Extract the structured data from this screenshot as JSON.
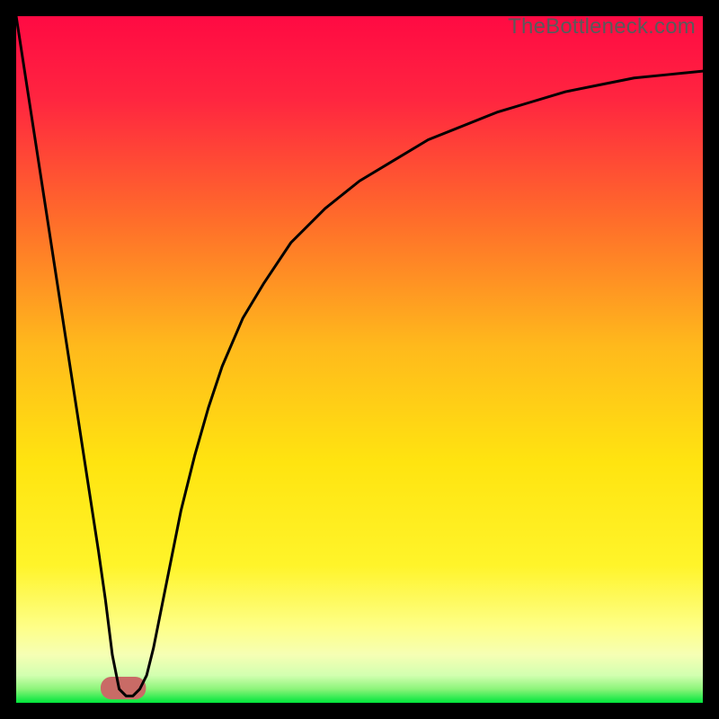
{
  "watermark": "TheBottleneck.com",
  "chart_data": {
    "type": "line",
    "title": "",
    "xlabel": "",
    "ylabel": "",
    "xlim": [
      0,
      100
    ],
    "ylim": [
      0,
      100
    ],
    "grid": false,
    "legend": false,
    "annotations": [],
    "series": [
      {
        "name": "bottleneck-curve",
        "description": "V-shaped black curve: steep linear descent from x=0,y=100 to minimum around x=15,y=1; minimum spans roughly x=13-19; then rises with decreasing slope toward x=100,y=92",
        "x": [
          0,
          2,
          4,
          6,
          8,
          10,
          12,
          13,
          14,
          15,
          16,
          17,
          18,
          19,
          20,
          22,
          24,
          26,
          28,
          30,
          33,
          36,
          40,
          45,
          50,
          55,
          60,
          65,
          70,
          75,
          80,
          85,
          90,
          95,
          100
        ],
        "values": [
          100,
          87,
          74,
          61,
          48,
          35,
          22,
          15,
          7,
          2,
          1,
          1,
          2,
          4,
          8,
          18,
          28,
          36,
          43,
          49,
          56,
          61,
          67,
          72,
          76,
          79,
          82,
          84,
          86,
          87.5,
          89,
          90,
          91,
          91.5,
          92
        ]
      }
    ],
    "gradient_bands": [
      {
        "y": 100,
        "color": "#ff0040"
      },
      {
        "y": 75,
        "color": "#ff7a1f"
      },
      {
        "y": 50,
        "color": "#ffd400"
      },
      {
        "y": 25,
        "color": "#fff200"
      },
      {
        "y": 8,
        "color": "#fdff9a"
      },
      {
        "y": 4,
        "color": "#dfffb0"
      },
      {
        "y": 0,
        "color": "#00e63b"
      }
    ],
    "minimum_marker": {
      "shape": "rounded-rect",
      "x_range": [
        12.3,
        18.9
      ],
      "y_range": [
        0.5,
        3.8
      ],
      "color": "#c96b66"
    }
  }
}
